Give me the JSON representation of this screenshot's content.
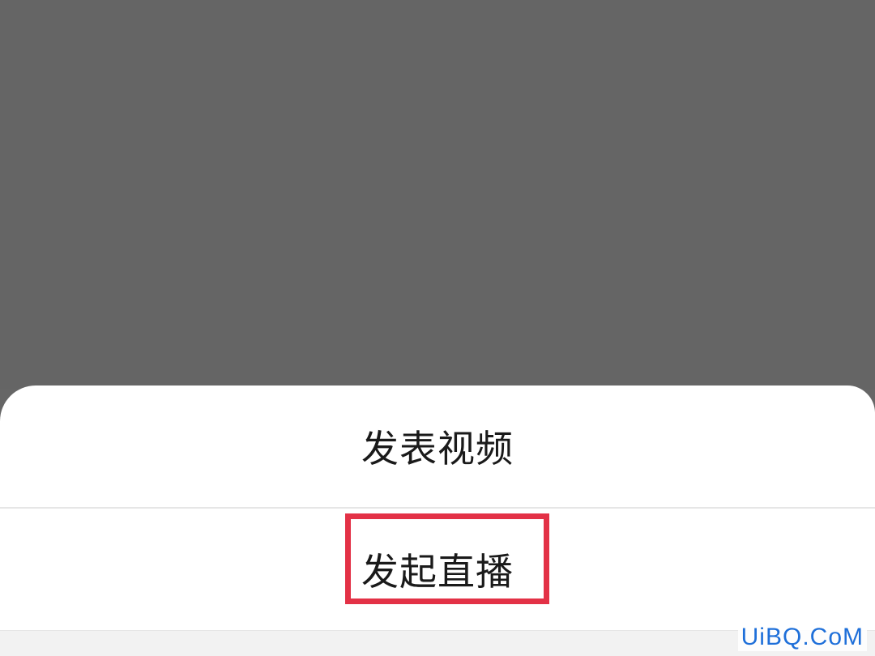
{
  "action_sheet": {
    "option_video": "发表视频",
    "option_live": "发起直播"
  },
  "watermark": {
    "text": "UiBQ.CoM"
  },
  "colors": {
    "overlay": "#666666",
    "sheet_background": "#ffffff",
    "highlight_border": "#e33146",
    "watermark": "#1e6fd9"
  }
}
